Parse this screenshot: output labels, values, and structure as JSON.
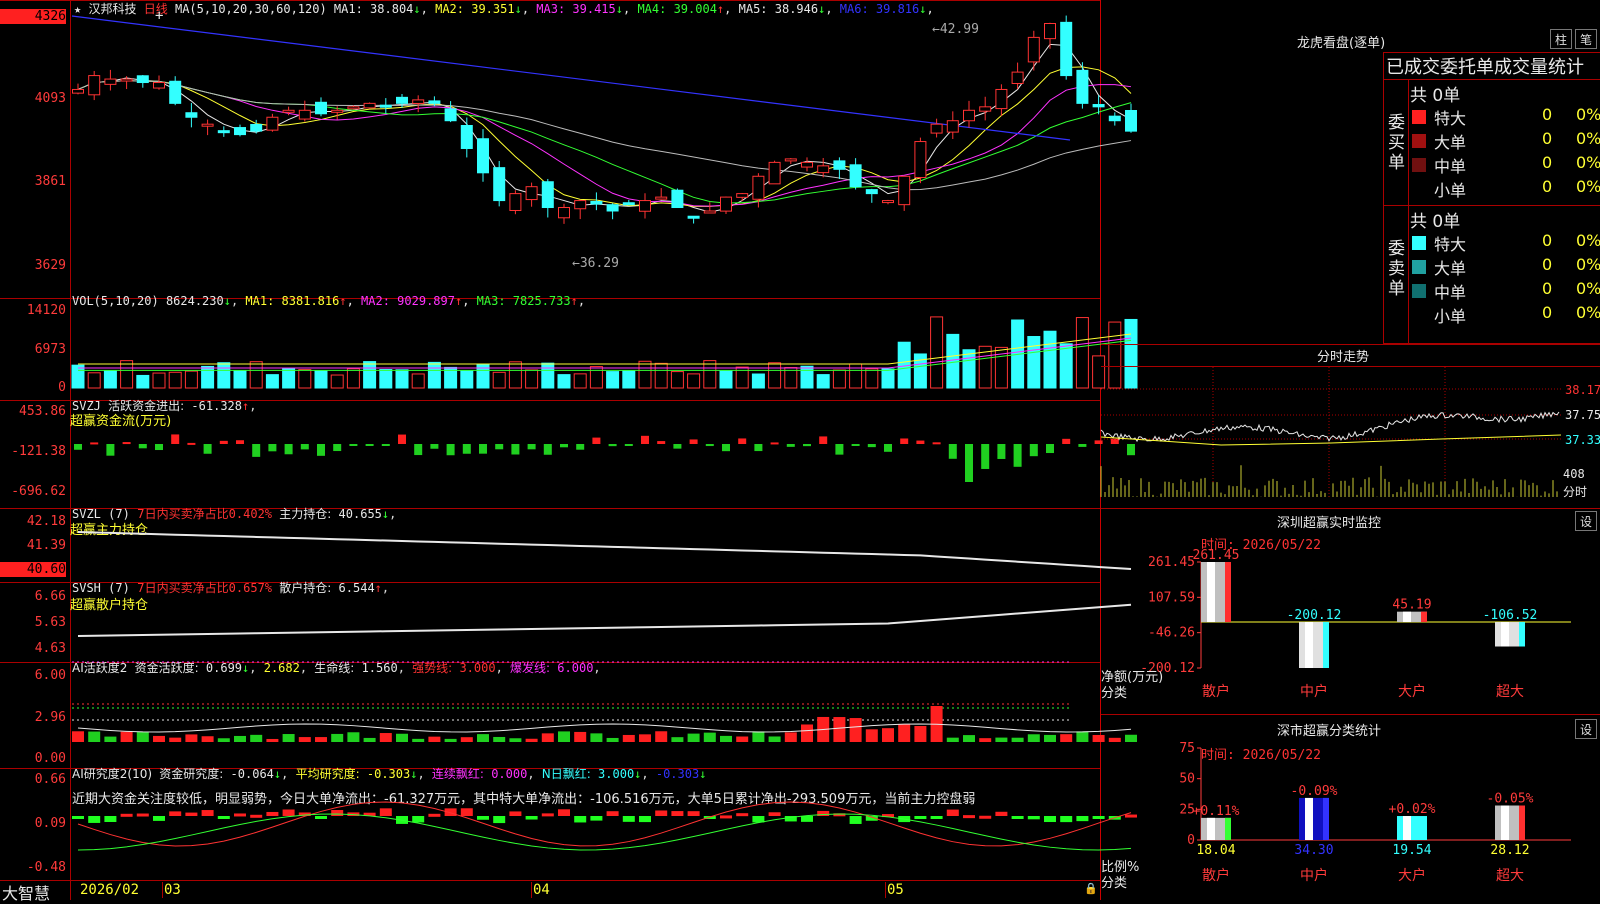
{
  "stock": {
    "name": "汉邦科技",
    "period": "日线",
    "star": "★"
  },
  "main": {
    "axis": [
      "4326",
      "4093",
      "3861",
      "3629"
    ],
    "ma_title": "MA(5,10,20,30,60,120)",
    "ma": [
      {
        "label": "MA1:",
        "value": "38.804",
        "arrow": "↓",
        "color": "#e8e8e8"
      },
      {
        "label": "MA2:",
        "value": "39.351",
        "arrow": "↓",
        "color": "#ffff33"
      },
      {
        "label": "MA3:",
        "value": "39.415",
        "arrow": "↓",
        "color": "#ff33ff"
      },
      {
        "label": "MA4:",
        "value": "39.004",
        "arrow": "↑",
        "color": "#33ff33"
      },
      {
        "label": "MA5:",
        "value": "38.946",
        "arrow": "↓",
        "color": "#e8e8e8"
      },
      {
        "label": "MA6:",
        "value": "39.816",
        "arrow": "↓",
        "color": "#3333ff"
      }
    ],
    "high_label": "←42.99",
    "low_label": "←36.29"
  },
  "vol": {
    "axis": [
      "14120",
      "6973",
      "0"
    ],
    "title": "VOL(5,10,20)",
    "value": "8624.230",
    "arrow": "↓",
    "items": [
      {
        "label": "MA1:",
        "value": "8381.816",
        "arrow": "↑",
        "color": "#ffff33"
      },
      {
        "label": "MA2:",
        "value": "9029.897",
        "arrow": "↑",
        "color": "#ff33ff"
      },
      {
        "label": "MA3:",
        "value": "7825.733",
        "arrow": "↑",
        "color": "#33ff33"
      }
    ]
  },
  "svzj": {
    "axis": [
      "453.86",
      "-121.38",
      "-696.62"
    ],
    "title": "SVZJ",
    "label": "活跃资金进出:",
    "value": "-61.328",
    "arrow": "↑",
    "sub": "超赢资金流(万元)"
  },
  "svzl": {
    "axis": [
      "42.18",
      "41.39",
      "40.60"
    ],
    "title": "SVZL (7)",
    "label1": "7日内买卖净占比",
    "value1": "0.402%",
    "label2": "主力持仓:",
    "value2": "40.655",
    "arrow": "↓",
    "sub": "超赢主力持仓"
  },
  "svsh": {
    "axis": [
      "6.66",
      "5.63",
      "4.63"
    ],
    "title": "SVSH (7)",
    "label1": "7日内买卖净占比",
    "value1": "0.657%",
    "label2": "散户持仓:",
    "value2": "6.544",
    "arrow": "↑",
    "sub": "超赢散户持仓"
  },
  "ai1": {
    "axis": [
      "6.00",
      "2.96",
      "0.00"
    ],
    "title": "AI活跃度2",
    "label": "资金活跃度:",
    "value": "0.699",
    "arrow": "↓",
    "value2": "2.682",
    "label3": "生命线:",
    "value3": "1.560",
    "label4": "强势线:",
    "value4": "3.000",
    "label5": "爆发线:",
    "value5": "6.000"
  },
  "ai2": {
    "axis": [
      "0.66",
      "0.09",
      "-0.48"
    ],
    "title": "AI研究度2(10)",
    "label1": "资金研究度:",
    "value1": "-0.064",
    "arrow1": "↓",
    "label2": "平均研究度:",
    "value2": "-0.303",
    "arrow2": "↓",
    "label3": "连续飘红:",
    "value3": "0.000",
    "label4": "N日飘红:",
    "value4": "3.000",
    "arrow4": "↓",
    "value5": "-0.303",
    "arrow5": "↓",
    "comment": "近期大资金关注度较低，明显弱势，今日大单净流出：-61.327万元，其中特大单净流出：-106.516万元，大单5日累计净出-293.509万元，当前主力控盘弱"
  },
  "xaxis": {
    "brand": "大智慧",
    "labels": [
      "2026/02",
      "03",
      "04",
      "05"
    ]
  },
  "right": {
    "title": "龙虎看盘(逐单)",
    "btn1": "柱",
    "btn2": "笔",
    "header": "已成交委托单成交量统计",
    "buy": {
      "side_label": "委买单",
      "total": "共 0单",
      "rows": [
        {
          "name": "特大",
          "num": "0",
          "pct": "0%",
          "color": "#ff2020"
        },
        {
          "name": "大单",
          "num": "0",
          "pct": "0%",
          "color": "#a01010"
        },
        {
          "name": "中单",
          "num": "0",
          "pct": "0%",
          "color": "#701010"
        },
        {
          "name": "小单",
          "num": "0",
          "pct": "0%",
          "color": ""
        }
      ]
    },
    "sell": {
      "side_label": "委卖单",
      "total": "共 0单",
      "rows": [
        {
          "name": "特大",
          "num": "0",
          "pct": "0%",
          "color": "#33ffff"
        },
        {
          "name": "大单",
          "num": "0",
          "pct": "0%",
          "color": "#20a0a0"
        },
        {
          "name": "中单",
          "num": "0",
          "pct": "0%",
          "color": "#107070"
        },
        {
          "name": "小单",
          "num": "0",
          "pct": "0%",
          "color": ""
        }
      ]
    },
    "intraday": {
      "title": "分时走势",
      "axis": [
        "38.17",
        "37.75",
        "37.33"
      ],
      "vol_axis": [
        "408",
        "分时"
      ]
    },
    "monitor": {
      "title": "深圳超赢实时监控",
      "btn": "设",
      "time": "时间: 2026/05/22",
      "axis": [
        "261.45",
        "107.59",
        "-46.26",
        "-200.12"
      ],
      "ylabel": "净额(万元)",
      "xlabel": "分类"
    },
    "classify": {
      "title": "深市超赢分类统计",
      "btn": "设",
      "time": "时间: 2026/05/22",
      "axis": [
        "75",
        "50",
        "25",
        "0"
      ],
      "ylabel": "比例%",
      "xlabel": "分类"
    }
  },
  "chart_data": [
    {
      "type": "bar",
      "title": "深圳超赢实时监控",
      "ylabel": "净额(万元)",
      "xlabel": "分类",
      "categories": [
        "散户",
        "中户",
        "大户",
        "超大"
      ],
      "values": [
        261.45,
        -200.12,
        45.19,
        -106.52
      ],
      "ylim": [
        -200.12,
        261.45
      ]
    },
    {
      "type": "bar",
      "title": "深市超赢分类统计",
      "ylabel": "比例%",
      "xlabel": "分类",
      "categories": [
        "散户",
        "中户",
        "大户",
        "超大"
      ],
      "values": [
        18.04,
        34.3,
        19.54,
        28.12
      ],
      "delta_labels": [
        "+0.11%",
        "-0.09%",
        "+0.02%",
        "-0.05%"
      ],
      "ylim": [
        0,
        75
      ]
    }
  ]
}
